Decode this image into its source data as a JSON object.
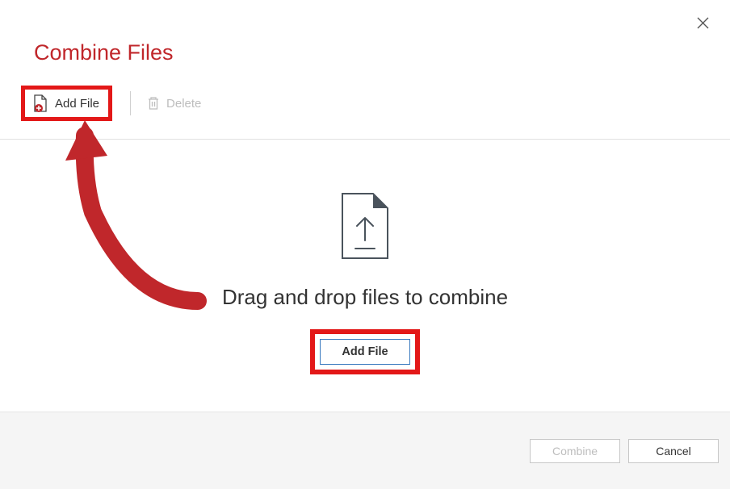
{
  "title": "Combine Files",
  "toolbar": {
    "add_file_label": "Add File",
    "delete_label": "Delete"
  },
  "dropzone": {
    "instruction": "Drag and drop files to combine",
    "add_file_label": "Add File"
  },
  "footer": {
    "combine_label": "Combine",
    "cancel_label": "Cancel"
  }
}
